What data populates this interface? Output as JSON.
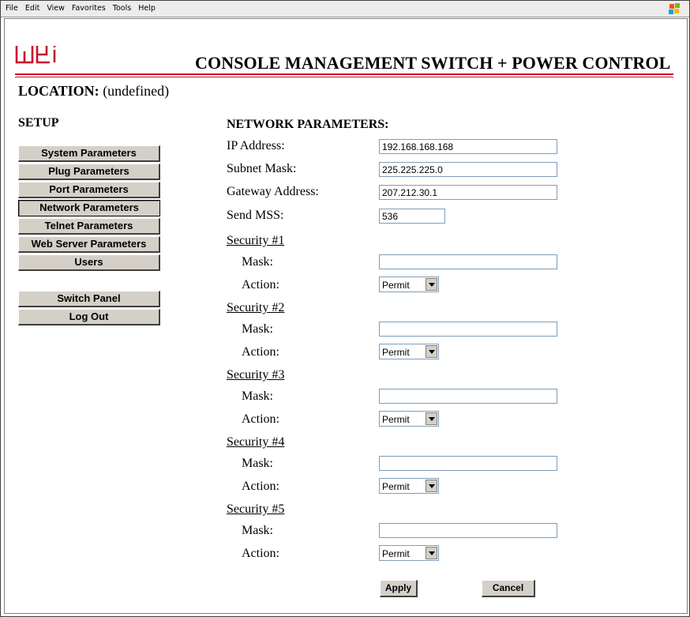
{
  "browser": {
    "menu": [
      "File",
      "Edit",
      "View",
      "Favorites",
      "Tools",
      "Help"
    ],
    "logo_icon": "windows-logo-icon"
  },
  "header": {
    "brand_logo": "wti",
    "title": "CONSOLE MANAGEMENT SWITCH + POWER CONTROL",
    "location_label": "LOCATION:",
    "location_value": "(undefined)",
    "accent_color": "#c8102e"
  },
  "sidebar": {
    "heading": "SETUP",
    "items": [
      {
        "label": "System Parameters"
      },
      {
        "label": "Plug Parameters"
      },
      {
        "label": "Port Parameters"
      },
      {
        "label": "Network Parameters"
      },
      {
        "label": "Telnet Parameters"
      },
      {
        "label": "Web Server Parameters"
      },
      {
        "label": "Users"
      }
    ],
    "items2": [
      {
        "label": "Switch Panel"
      },
      {
        "label": "Log Out"
      }
    ]
  },
  "main": {
    "section_title": "NETWORK PARAMETERS:",
    "fields": {
      "ip_label": "IP Address:",
      "ip_value": "192.168.168.168",
      "subnet_label": "Subnet Mask:",
      "subnet_value": "225.225.225.0",
      "gateway_label": "Gateway Address:",
      "gateway_value": "207.212.30.1",
      "mss_label": "Send MSS:",
      "mss_value": "536"
    },
    "security": [
      {
        "heading": "Security #1",
        "mask_label": "Mask:",
        "mask_value": "",
        "action_label": "Action:",
        "action_value": "Permit"
      },
      {
        "heading": "Security #2",
        "mask_label": "Mask:",
        "mask_value": "",
        "action_label": "Action:",
        "action_value": "Permit"
      },
      {
        "heading": "Security #3",
        "mask_label": "Mask:",
        "mask_value": "",
        "action_label": "Action:",
        "action_value": "Permit"
      },
      {
        "heading": "Security #4",
        "mask_label": "Mask:",
        "mask_value": "",
        "action_label": "Action:",
        "action_value": "Permit"
      },
      {
        "heading": "Security #5",
        "mask_label": "Mask:",
        "mask_value": "",
        "action_label": "Action:",
        "action_value": "Permit"
      }
    ],
    "apply_label": "Apply",
    "cancel_label": "Cancel"
  }
}
